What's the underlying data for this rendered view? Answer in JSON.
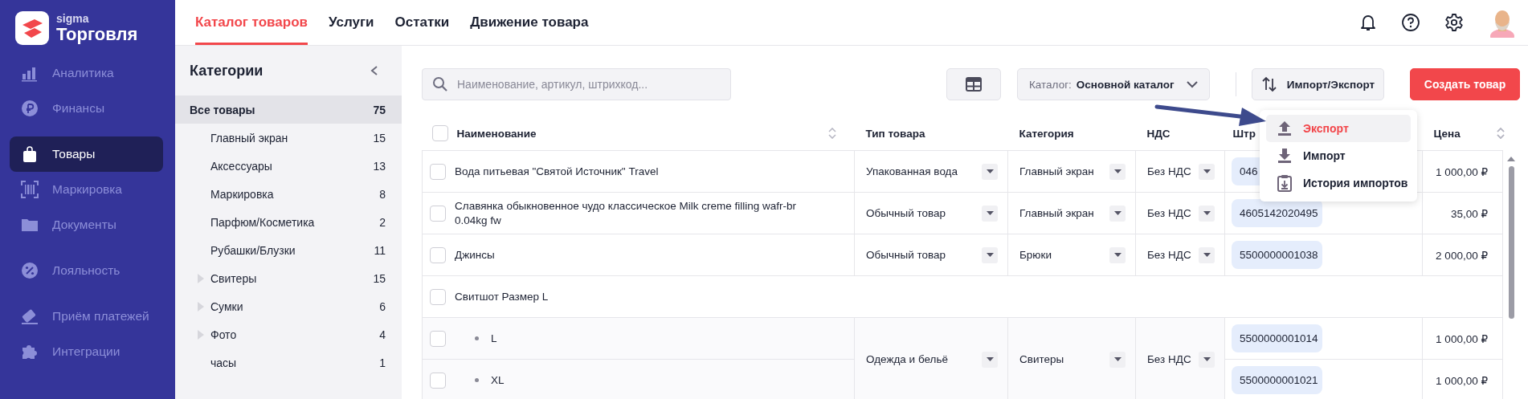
{
  "brand": {
    "small": "sigma",
    "name": "Торговля"
  },
  "nav_sections": [
    {
      "items": [
        {
          "label": "Аналитика",
          "selected": false
        },
        {
          "label": "Финансы",
          "selected": false
        }
      ]
    },
    {
      "items": [
        {
          "label": "Товары",
          "selected": true
        },
        {
          "label": "Маркировка",
          "selected": false
        },
        {
          "label": "Документы",
          "selected": false
        }
      ]
    },
    {
      "items": [
        {
          "label": "Лояльность",
          "selected": false
        }
      ]
    },
    {
      "items": [
        {
          "label": "Приём платежей",
          "selected": false
        },
        {
          "label": "Интеграции",
          "selected": false
        }
      ]
    }
  ],
  "tabs": [
    {
      "label": "Каталог товаров",
      "selected": true
    },
    {
      "label": "Услуги",
      "selected": false
    },
    {
      "label": "Остатки",
      "selected": false
    },
    {
      "label": "Движение товара",
      "selected": false
    }
  ],
  "categories": {
    "title": "Категории",
    "items": [
      {
        "label": "Все товары",
        "count": "75",
        "selected": true,
        "children": [
          {
            "label": "Главный экран",
            "count": "15",
            "selected": false
          },
          {
            "label": "Аксессуары",
            "count": "13",
            "selected": false
          },
          {
            "label": "Маркировка",
            "count": "8",
            "selected": false
          },
          {
            "label": "Парфюм/Косметика",
            "count": "2",
            "selected": false
          },
          {
            "label": "Рубашки/Блузки",
            "count": "11",
            "selected": false
          },
          {
            "label": "Свитеры",
            "count": "15",
            "selected": false,
            "expanded": false
          },
          {
            "label": "Сумки",
            "count": "6",
            "selected": false,
            "expanded": false
          },
          {
            "label": "Фото",
            "count": "4",
            "selected": false,
            "expanded": false
          },
          {
            "label": "часы",
            "count": "1",
            "selected": false
          }
        ]
      }
    ]
  },
  "toolbar": {
    "search": {
      "placeholder": "Наименование, артикул, штрихкод..."
    },
    "catalog": {
      "label": "Каталог:",
      "value": "Основной каталог"
    },
    "import_export": "Импорт/Экспорт",
    "create": "Создать товар"
  },
  "table": {
    "header_checked": false,
    "columns": [
      {
        "label": "Наименование",
        "sortable": true
      },
      {
        "label": "Тип товара",
        "sortable": false
      },
      {
        "label": "Категория",
        "sortable": false
      },
      {
        "label": "НДС",
        "sortable": false
      },
      {
        "label": "Штр"
      },
      {
        "label": "Цена",
        "sortable": true
      }
    ],
    "rows": [
      {
        "kind": "product",
        "checked": false,
        "name": "Вода питьевая \"Святой Источник\" Travel",
        "type": "Упакованная вода",
        "category": "Главный экран",
        "vat": "Без НДС",
        "barcode": "046",
        "price": "1 000,00 ₽"
      },
      {
        "kind": "product",
        "checked": false,
        "name": "Славянка обыкновенное чудо классическое Milk creme filling wafr-br 0.04kg fw",
        "type": "Обычный товар",
        "category": "Главный экран",
        "vat": "Без НДС",
        "barcode": "4605142020495",
        "price": "35,00 ₽"
      },
      {
        "kind": "product",
        "checked": false,
        "name": "Джинсы",
        "type": "Обычный товар",
        "category": "Брюки",
        "vat": "Без НДС",
        "barcode": "5500000001038",
        "price": "2 000,00 ₽"
      },
      {
        "kind": "group",
        "checked": false,
        "name": "Свитшот Размер L",
        "type": "Одежда и бельё",
        "category": "Свитеры",
        "vat": "Без НДС",
        "variants": [
          {
            "checked": false,
            "name": "L",
            "barcode": "5500000001014",
            "price": "1 000,00 ₽"
          },
          {
            "checked": false,
            "name": "XL",
            "barcode": "5500000001021",
            "price": "1 000,00 ₽"
          }
        ]
      }
    ]
  },
  "menu": {
    "items": [
      {
        "label": "Экспорт",
        "selected": true
      },
      {
        "label": "Импорт",
        "selected": false
      },
      {
        "label": "История импортов",
        "selected": false
      }
    ]
  }
}
